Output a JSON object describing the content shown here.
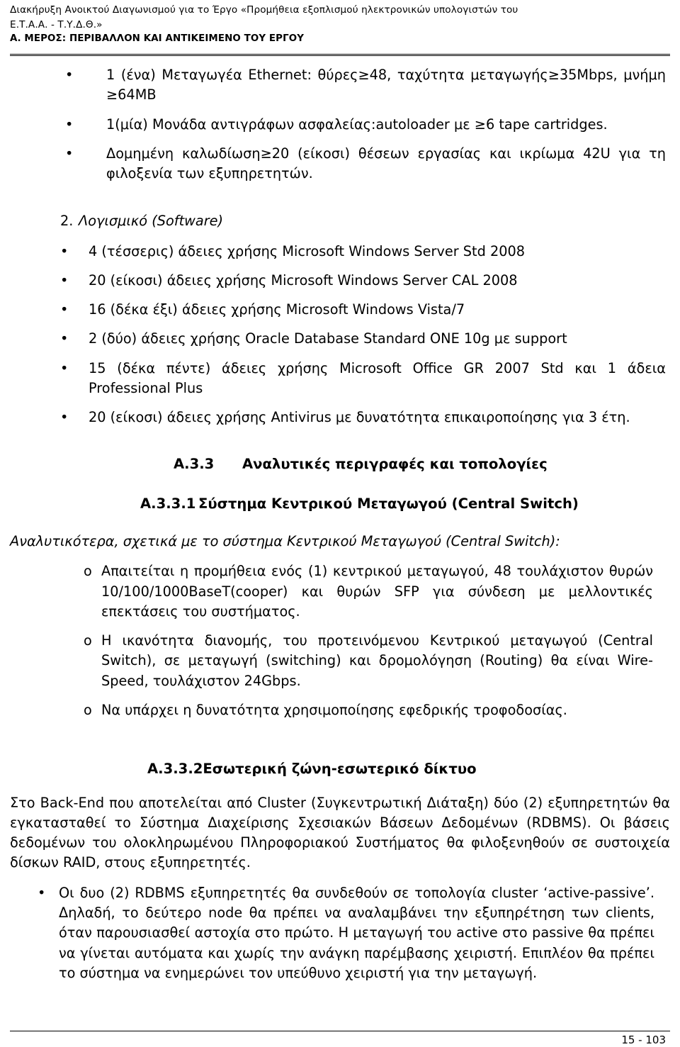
{
  "header": {
    "line1": "Διακήρυξη Ανοικτού Διαγωνισμού για το Έργο  «Προμήθεια  εξοπλισμού ηλεκτρονικών υπολογιστών του",
    "line2": "Ε.Τ.Α.Α. - Τ.Υ.Δ.Θ.»",
    "line3": "Α. ΜΕΡΟΣ: ΠΕΡΙΒΑΛΛΟΝ ΚΑΙ ΑΝΤΙΚΕΙΜΕΝΟ ΤΟΥ ΕΡΓΟΥ"
  },
  "hardware_bullets": [
    {
      "marker": "•",
      "text": "1 (ένα) Μεταγωγέα Ethernet: θύρες≥48, ταχύτητα μεταγωγής≥35Mbps, μνήμη ≥64MB"
    },
    {
      "marker": "•",
      "text": "1(μία) Μονάδα αντιγράφων ασφαλείας:autoloader με ≥6 tape cartridges."
    },
    {
      "marker": "•",
      "text": "Δομημένη καλωδίωση≥20 (είκοσι) θέσεων εργασίας και ικρίωμα 42U για τη φιλοξενία των εξυπηρετητών."
    }
  ],
  "software_section": {
    "number": "2.",
    "title": "Λογισμικό (Software)",
    "bullets": [
      {
        "marker": "•",
        "text": "4 (τέσσερις) άδειες χρήσης Microsoft Windows Server Std 2008"
      },
      {
        "marker": "•",
        "text": "20 (είκοσι) άδειες χρήσης Microsoft Windows Server CAL 2008"
      },
      {
        "marker": "•",
        "text": "16 (δέκα έξι) άδειες χρήσης Microsoft Windows Vista/7"
      },
      {
        "marker": "•",
        "text": "2 (δύο) άδειες χρήσης Oracle Database Standard ONE 10g με support"
      },
      {
        "marker": "•",
        "text": "15 (δέκα πέντε) άδειες χρήσης Microsoft Office GR 2007 Std και 1 άδεια Professional Plus"
      },
      {
        "marker": "•",
        "text": "20 (είκοσι) άδειες χρήσης Antivirus με δυνατότητα επικαιροποίησης για 3 έτη."
      }
    ]
  },
  "heading_a33": {
    "label": "Α.3.3",
    "title": "Αναλυτικές περιγραφές και τοπολογίες"
  },
  "heading_a331": {
    "label": "Α.3.3.1",
    "title": "Σύστημα Κεντρικού Μεταγωγού (Central Switch)"
  },
  "central_switch": {
    "lead": "Αναλυτικότερα, σχετικά με το σύστημα Κεντρικού Μεταγωγού (Central Switch):",
    "items": [
      {
        "marker": "o",
        "text": "Απαιτείται η προμήθεια ενός (1) κεντρικού μεταγωγού, 48 τουλάχιστον θυρών 10/100/1000BaseT(cooper) και θυρών SFP για σύνδεση με μελλοντικές επεκτάσεις του συστήματος."
      },
      {
        "marker": "o",
        "text": "Η ικανότητα διανομής, του προτεινόμενου Κεντρικού μεταγωγού (Central Switch), σε μεταγωγή (switching) και δρομολόγηση (Routing) θα είναι Wire-Speed, τουλάχιστον 24Gbps."
      },
      {
        "marker": "o",
        "text": "Να υπάρχει η δυνατότητα χρησιμοποίησης εφεδρικής τροφοδοσίας."
      }
    ]
  },
  "heading_a332": {
    "text": "Α.3.3.2Εσωτερική ζώνη-εσωτερικό δίκτυο"
  },
  "internal_zone": {
    "paragraph": "Στο Back-End που αποτελείται από Cluster (Συγκεντρωτική Διάταξη) δύο (2) εξυπηρετητών θα εγκατασταθεί το Σύστημα Διαχείρισης Σχεσιακών Βάσεων Δεδομένων (RDBMS). Οι βάσεις δεδομένων του ολοκληρωμένου Πληροφοριακού Συστήματος θα φιλοξενηθούν σε συστοιχεία δίσκων RAID, στους εξυπηρετητές.",
    "bullets": [
      {
        "marker": "•",
        "text": "Οι δυο (2) RDBMS εξυπηρετητές θα συνδεθούν σε τοπολογία cluster ‘active-passive’. Δηλαδή, το δεύτερο node θα πρέπει να αναλαμβάνει την εξυπηρέτηση των clients, όταν παρουσιασθεί αστοχία στο πρώτο. Η μεταγωγή του active στο passive θα πρέπει να γίνεται αυτόματα και χωρίς την ανάγκη παρέμβασης χειριστή. Επιπλέον θα πρέπει το σύστημα να ενημερώνει τον υπεύθυνο χειριστή για την μεταγωγή."
      }
    ]
  },
  "footer": {
    "page_number": "15 - 103"
  }
}
